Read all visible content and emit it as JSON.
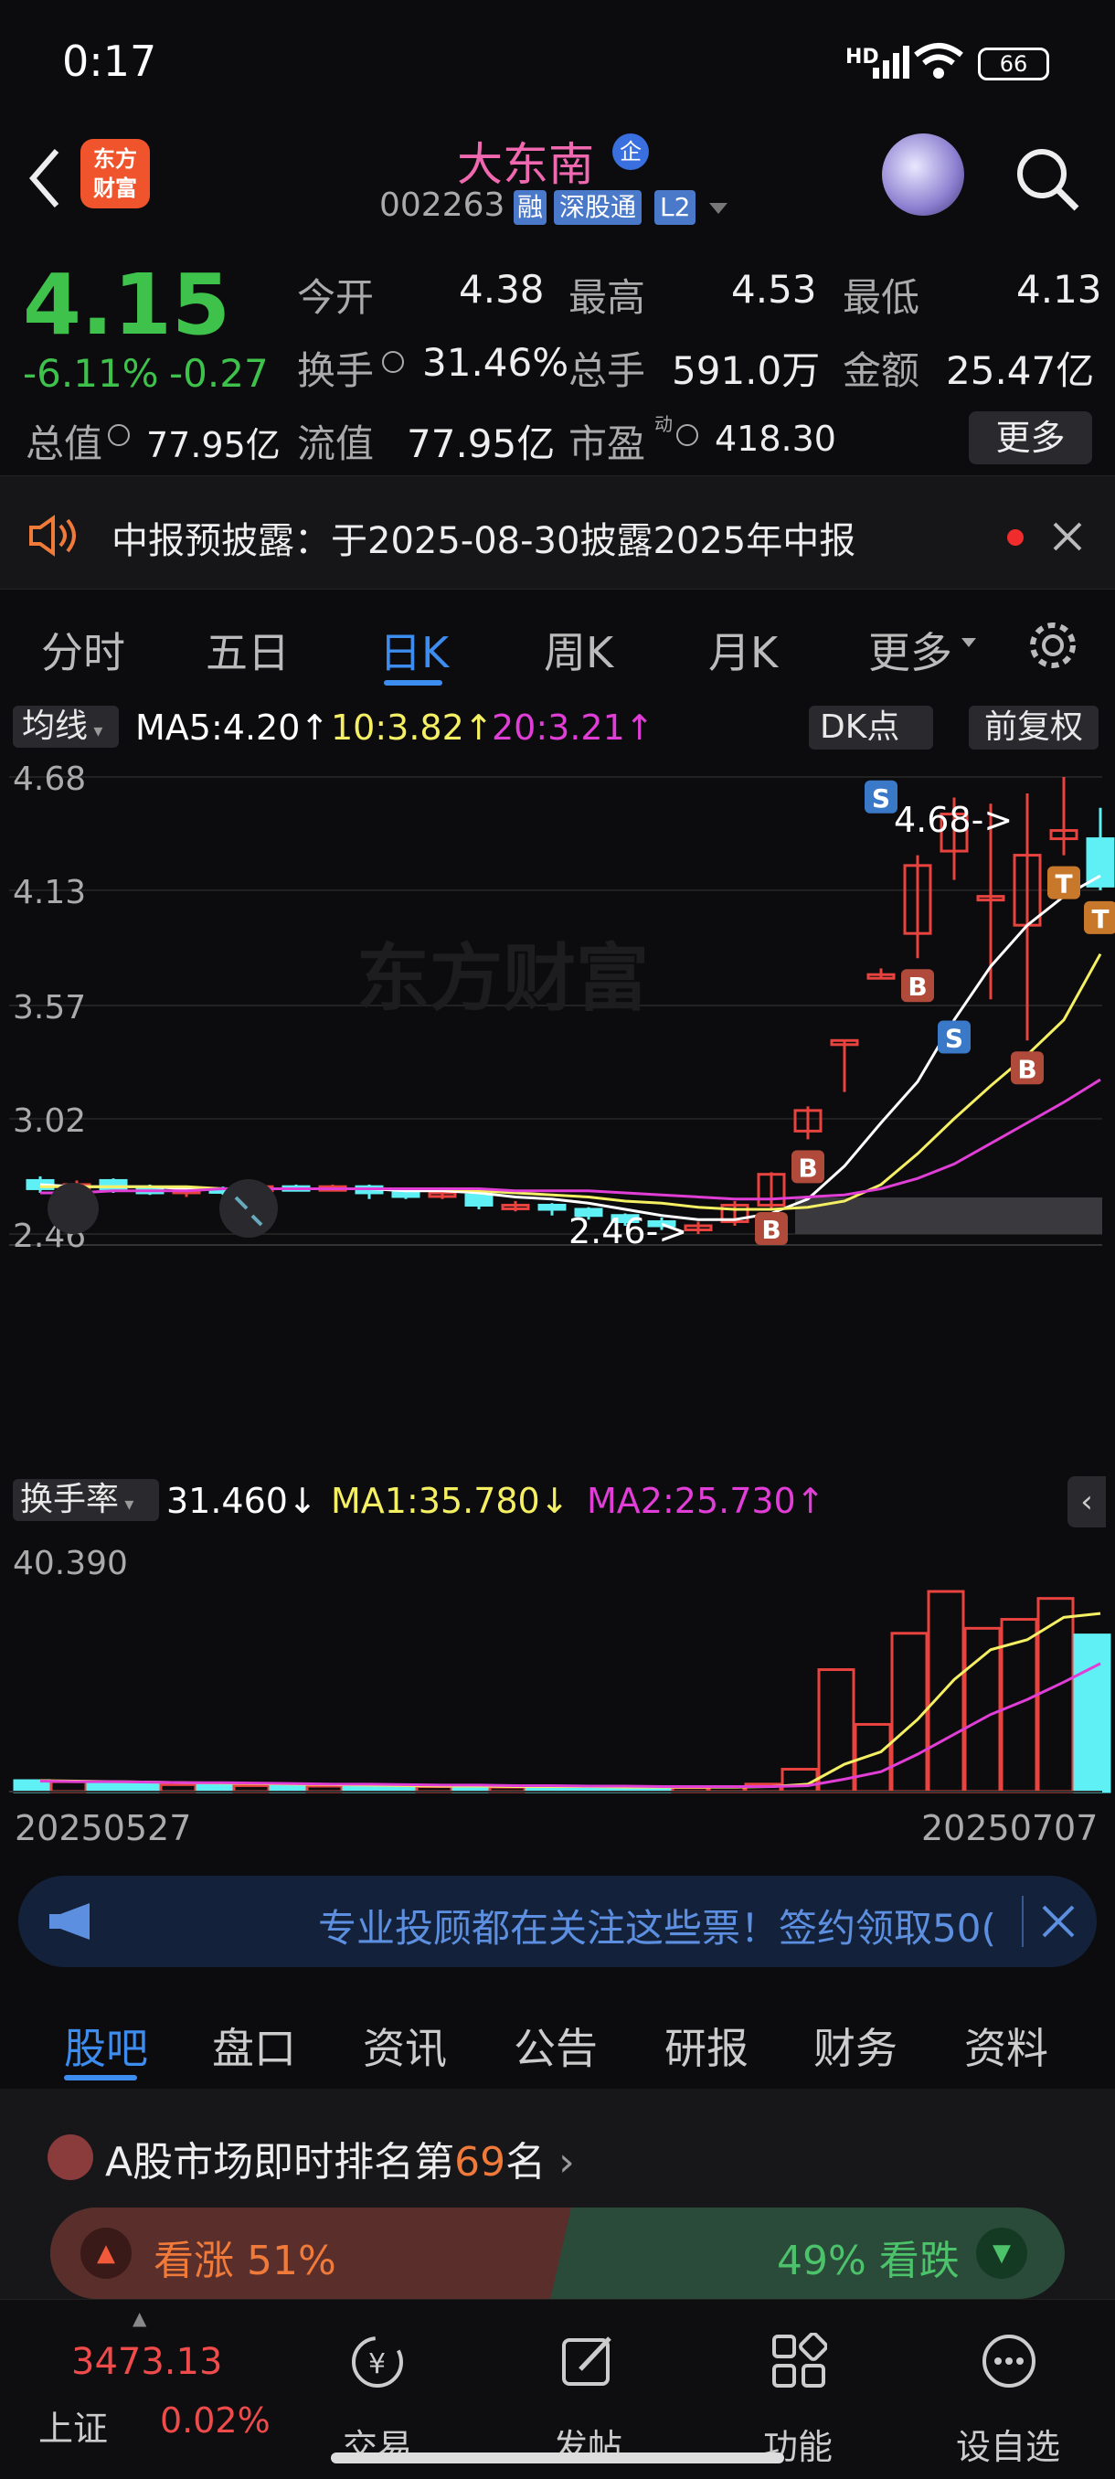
{
  "status": {
    "time": "0:17",
    "battery": "66",
    "network": "HD"
  },
  "header": {
    "logo_line1": "东方",
    "logo_line2": "财富",
    "stock_name": "大东南",
    "badge_qi": "企",
    "stock_code": "002263",
    "tag_rong": "融",
    "tag_sgt": "深股通",
    "tag_l2": "L2"
  },
  "quote": {
    "price": "4.15",
    "change_pct": "-6.11%",
    "change": "-0.27",
    "open_label": "今开",
    "open": "4.38",
    "high_label": "最高",
    "high": "4.53",
    "low_label": "最低",
    "low": "4.13",
    "turnover_label": "换手",
    "turnover": "31.46%",
    "volume_label": "总手",
    "volume": "591.0万",
    "amount_label": "金额",
    "amount": "25.47亿",
    "mktcap_label": "总值",
    "mktcap": "77.95亿",
    "float_label": "流值",
    "float_cap": "77.95亿",
    "pe_label": "市盈",
    "pe_sup": "动",
    "pe": "418.30",
    "more_label": "更多"
  },
  "notice": {
    "text": "中报预披露：于2025-08-30披露2025年中报"
  },
  "tabs": [
    "分时",
    "五日",
    "日K",
    "周K",
    "月K",
    "更多"
  ],
  "active_tab": 2,
  "kline": {
    "ma_selector": "均线",
    "ma5": "MA5:4.20",
    "ma10": "10:3.82",
    "ma20": "20:3.21",
    "dk_label": "DK点",
    "adjust_label": "前复权",
    "y_ticks": [
      "4.68",
      "4.13",
      "3.57",
      "3.02",
      "2.46"
    ],
    "max_note": "4.68->",
    "min_note": "2.46->",
    "watermark": "东方财富",
    "colors": {
      "up": "#e8433e",
      "down": "#5ff0f5",
      "ma5": "#ffffff",
      "ma10": "#f5f063",
      "ma20": "#e03ed6"
    }
  },
  "turnover_chart": {
    "selector": "换手率",
    "value": "31.460",
    "ma1": "MA1:35.780",
    "ma2": "MA2:25.730",
    "top_value": "40.390",
    "date_start": "20250527",
    "date_end": "20250707"
  },
  "chart_data": [
    {
      "type": "candlestick",
      "title": "",
      "y_ticks": [
        "4.68",
        "4.13",
        "3.57",
        "3.02",
        "2.46"
      ],
      "ylim": [
        2.46,
        4.68
      ],
      "candles": [
        {
          "o": 2.72,
          "c": 2.68,
          "h": 2.74,
          "l": 2.66
        },
        {
          "o": 2.68,
          "c": 2.7,
          "h": 2.72,
          "l": 2.66
        },
        {
          "o": 2.72,
          "c": 2.68,
          "h": 2.73,
          "l": 2.66
        },
        {
          "o": 2.68,
          "c": 2.66,
          "h": 2.7,
          "l": 2.65
        },
        {
          "o": 2.66,
          "c": 2.68,
          "h": 2.69,
          "l": 2.64
        },
        {
          "o": 2.68,
          "c": 2.67,
          "h": 2.69,
          "l": 2.65
        },
        {
          "o": 2.67,
          "c": 2.69,
          "h": 2.7,
          "l": 2.66
        },
        {
          "o": 2.69,
          "c": 2.68,
          "h": 2.7,
          "l": 2.67
        },
        {
          "o": 2.68,
          "c": 2.69,
          "h": 2.7,
          "l": 2.67
        },
        {
          "o": 2.69,
          "c": 2.66,
          "h": 2.7,
          "l": 2.63
        },
        {
          "o": 2.66,
          "c": 2.65,
          "h": 2.68,
          "l": 2.63
        },
        {
          "o": 2.65,
          "c": 2.66,
          "h": 2.67,
          "l": 2.63
        },
        {
          "o": 2.65,
          "c": 2.6,
          "h": 2.66,
          "l": 2.58
        },
        {
          "o": 2.6,
          "c": 2.6,
          "h": 2.62,
          "l": 2.57
        },
        {
          "o": 2.6,
          "c": 2.58,
          "h": 2.61,
          "l": 2.55
        },
        {
          "o": 2.58,
          "c": 2.55,
          "h": 2.59,
          "l": 2.53
        },
        {
          "o": 2.55,
          "c": 2.52,
          "h": 2.56,
          "l": 2.5
        },
        {
          "o": 2.52,
          "c": 2.5,
          "h": 2.54,
          "l": 2.48
        },
        {
          "o": 2.48,
          "c": 2.5,
          "h": 2.52,
          "l": 2.46
        },
        {
          "o": 2.52,
          "c": 2.6,
          "h": 2.62,
          "l": 2.5
        },
        {
          "o": 2.6,
          "c": 2.75,
          "h": 2.76,
          "l": 2.58
        },
        {
          "o": 2.96,
          "c": 3.06,
          "h": 3.08,
          "l": 2.92
        },
        {
          "o": 3.38,
          "c": 3.4,
          "h": 3.4,
          "l": 3.15
        },
        {
          "o": 3.72,
          "c": 3.72,
          "h": 3.75,
          "l": 3.7
        },
        {
          "o": 3.92,
          "c": 4.25,
          "h": 4.3,
          "l": 3.8
        },
        {
          "o": 4.32,
          "c": 4.5,
          "h": 4.58,
          "l": 4.18
        },
        {
          "o": 4.1,
          "c": 4.1,
          "h": 4.55,
          "l": 3.6
        },
        {
          "o": 3.96,
          "c": 4.3,
          "h": 4.6,
          "l": 3.4
        },
        {
          "o": 4.38,
          "c": 4.42,
          "h": 4.68,
          "l": 4.3
        },
        {
          "o": 4.38,
          "c": 4.15,
          "h": 4.53,
          "l": 4.13
        }
      ],
      "series": [
        {
          "name": "MA5",
          "values": [
            2.7,
            2.69,
            2.69,
            2.69,
            2.68,
            2.68,
            2.68,
            2.68,
            2.68,
            2.68,
            2.67,
            2.67,
            2.66,
            2.64,
            2.63,
            2.61,
            2.58,
            2.55,
            2.53,
            2.53,
            2.56,
            2.63,
            2.79,
            3.0,
            3.2,
            3.5,
            3.76,
            3.96,
            4.1,
            4.2
          ]
        },
        {
          "name": "10",
          "values": [
            2.69,
            2.69,
            2.69,
            2.69,
            2.69,
            2.68,
            2.68,
            2.68,
            2.68,
            2.68,
            2.68,
            2.68,
            2.67,
            2.66,
            2.65,
            2.64,
            2.62,
            2.61,
            2.59,
            2.58,
            2.58,
            2.59,
            2.62,
            2.7,
            2.85,
            3.02,
            3.18,
            3.33,
            3.5,
            3.82
          ]
        },
        {
          "name": "20",
          "values": [
            2.66,
            2.66,
            2.67,
            2.67,
            2.67,
            2.68,
            2.68,
            2.68,
            2.68,
            2.68,
            2.68,
            2.68,
            2.68,
            2.67,
            2.67,
            2.67,
            2.66,
            2.65,
            2.64,
            2.63,
            2.63,
            2.64,
            2.65,
            2.68,
            2.73,
            2.8,
            2.9,
            3.0,
            3.1,
            3.21
          ]
        }
      ]
    },
    {
      "type": "bar",
      "title": "换手率",
      "ylim": [
        0,
        40.39
      ],
      "top_tick": "40.390",
      "x_start": "20250527",
      "x_end": "20250707",
      "values": [
        2.2,
        2.0,
        1.8,
        1.5,
        1.4,
        1.3,
        1.2,
        1.2,
        1.1,
        1.1,
        1.0,
        1.0,
        1.0,
        0.9,
        0.9,
        0.9,
        0.8,
        0.8,
        0.8,
        1.0,
        1.5,
        4.5,
        24.5,
        13.5,
        31.8,
        40.2,
        32.8,
        34.6,
        38.8,
        31.46
      ],
      "series": [
        {
          "name": "MA1",
          "values": [
            2.2,
            2.1,
            2.0,
            1.9,
            1.8,
            1.7,
            1.6,
            1.5,
            1.4,
            1.3,
            1.2,
            1.1,
            1.1,
            1.0,
            1.0,
            1.0,
            0.9,
            0.9,
            0.9,
            0.9,
            1.0,
            1.5,
            5.5,
            8.0,
            14.5,
            22.5,
            28.5,
            30.5,
            35.0,
            35.78
          ]
        },
        {
          "name": "MA2",
          "values": [
            2.1,
            2.0,
            2.0,
            1.9,
            1.8,
            1.8,
            1.7,
            1.6,
            1.5,
            1.5,
            1.4,
            1.3,
            1.3,
            1.2,
            1.2,
            1.1,
            1.1,
            1.0,
            1.0,
            1.0,
            1.0,
            1.2,
            2.5,
            4.0,
            7.5,
            11.5,
            15.5,
            18.5,
            22.0,
            25.73
          ]
        }
      ]
    }
  ],
  "banner": {
    "text": "专业投顾都在关注这些票！签约领取50("
  },
  "subtabs": [
    "股吧",
    "盘口",
    "资讯",
    "公告",
    "研报",
    "财务",
    "资料"
  ],
  "rank": {
    "prefix": "A股市场即时排名第",
    "number": "69",
    "suffix": "名",
    "up_label": "看涨 51%",
    "down_label": "49% 看跌"
  },
  "bottom": {
    "index_value": "3473.13",
    "index_name": "上证",
    "index_change": "0.02%",
    "items": [
      "交易",
      "发帖",
      "功能",
      "设自选"
    ]
  }
}
